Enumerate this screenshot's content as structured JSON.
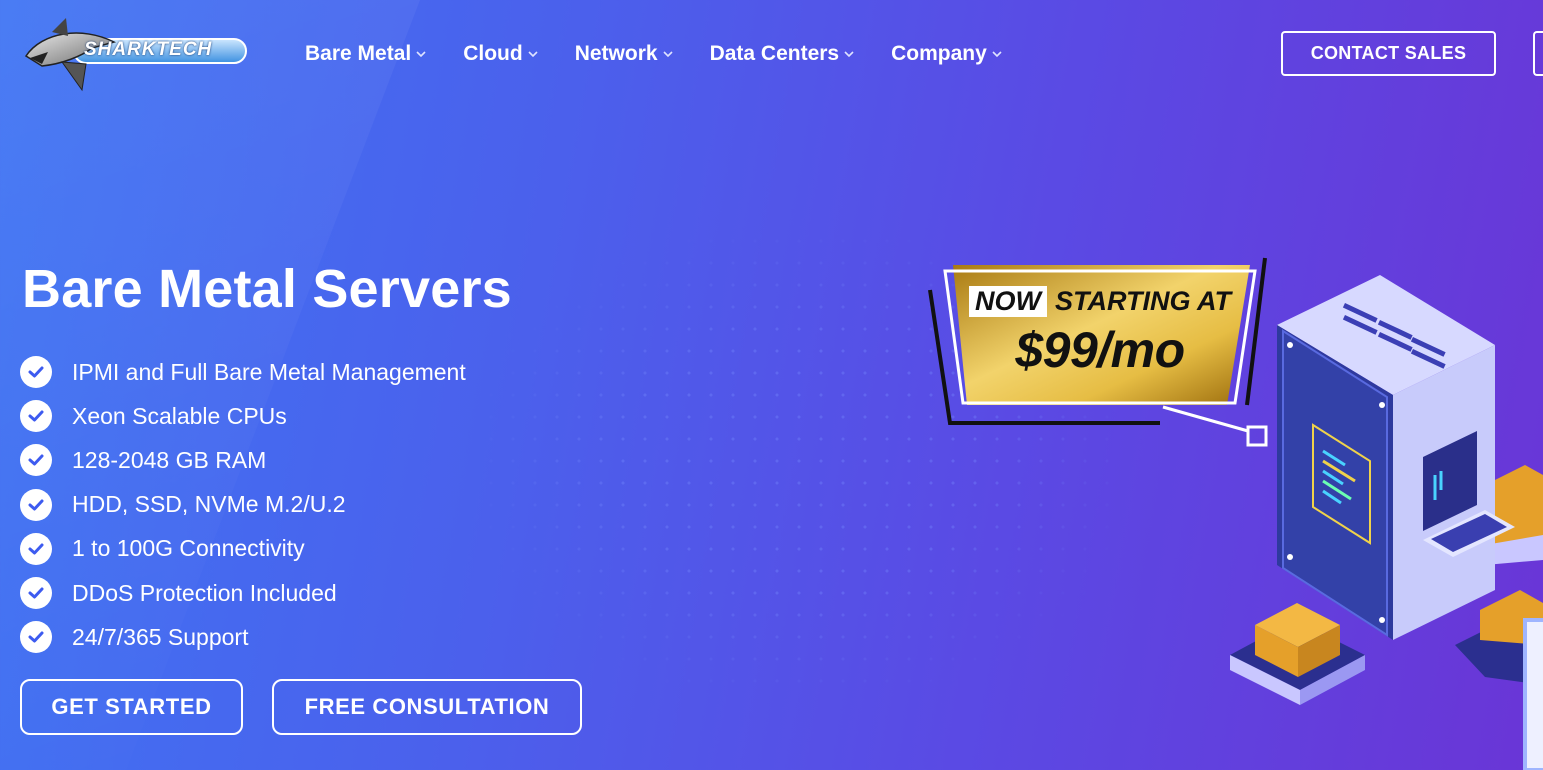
{
  "header": {
    "logo_text": "SHARKTECH",
    "nav": [
      {
        "label": "Bare Metal"
      },
      {
        "label": "Cloud"
      },
      {
        "label": "Network"
      },
      {
        "label": "Data Centers"
      },
      {
        "label": "Company"
      }
    ],
    "contact_label": "CONTACT SALES"
  },
  "hero": {
    "title": "Bare Metal Servers",
    "features": [
      "IPMI and Full Bare Metal Management",
      "Xeon Scalable CPUs",
      "128-2048 GB RAM",
      "HDD, SSD, NVMe M.2/U.2",
      "1 to 100G Connectivity",
      "DDoS Protection Included",
      "24/7/365 Support"
    ],
    "get_started_label": "GET STARTED",
    "consultation_label": "FREE CONSULTATION"
  },
  "badge": {
    "now": "NOW",
    "starting": "STARTING AT",
    "price": "$99/mo"
  },
  "colors": {
    "bg_start": "#3f74f3",
    "bg_end": "#6a35d6",
    "gold": "#d4a52a",
    "check_blue": "#3d5bf0"
  }
}
